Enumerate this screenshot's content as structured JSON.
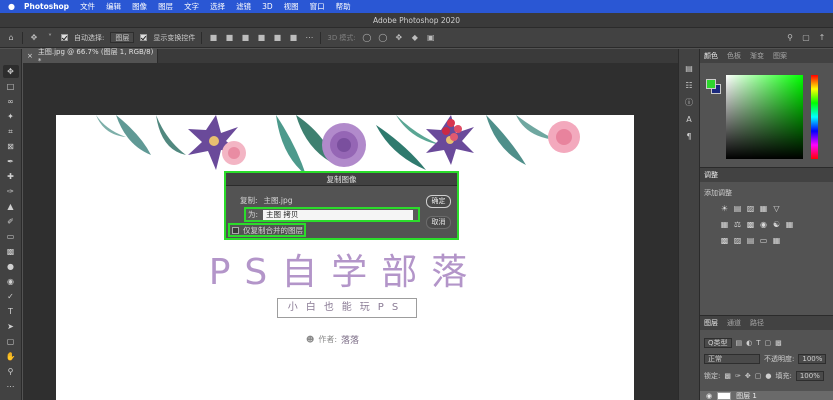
{
  "menubar": {
    "apple": "",
    "items": [
      "Photoshop",
      "文件",
      "编辑",
      "图像",
      "图层",
      "文字",
      "选择",
      "滤镜",
      "3D",
      "视图",
      "窗口",
      "帮助"
    ]
  },
  "window": {
    "title": "Adobe Photoshop 2020"
  },
  "options": {
    "auto_select_label": "自动选择:",
    "auto_select_value": "图层",
    "show_transform_label": "显示变换控件",
    "mode_3d_label": "3D 模式:"
  },
  "document": {
    "tab_label": "主图.jpg @ 66.7% (图层 1, RGB/8) *",
    "big_title": "PS自学部落",
    "subtitle": "小白也能玩PS",
    "author_label": "作者:",
    "author_name": "落落"
  },
  "dialog": {
    "title": "复制图像",
    "copy_label": "复制:",
    "copy_value": "主图.jpg",
    "as_label": "为:",
    "as_value": "主图 拷贝",
    "merged_only_label": "仅复制合并的图层",
    "ok_label": "确定",
    "cancel_label": "取消"
  },
  "panels": {
    "color_tabs": [
      "颜色",
      "色板",
      "渐变",
      "图案"
    ],
    "adjust_tab": "调整",
    "adjust_add_label": "添加调整",
    "layers_tabs": [
      "图层",
      "通道",
      "路径"
    ],
    "filter_kind": "Q类型",
    "blend_mode": "正常",
    "opacity_label": "不透明度:",
    "opacity_value": "100%",
    "lock_label": "锁定:",
    "fill_label": "填充:",
    "fill_value": "100%",
    "layer_name": "图层 1"
  },
  "colors": {
    "foreground": "#2dd62d",
    "background": "#1c2a7e",
    "highlight": "#2bdc2b",
    "title_purple": "#b395c9"
  }
}
